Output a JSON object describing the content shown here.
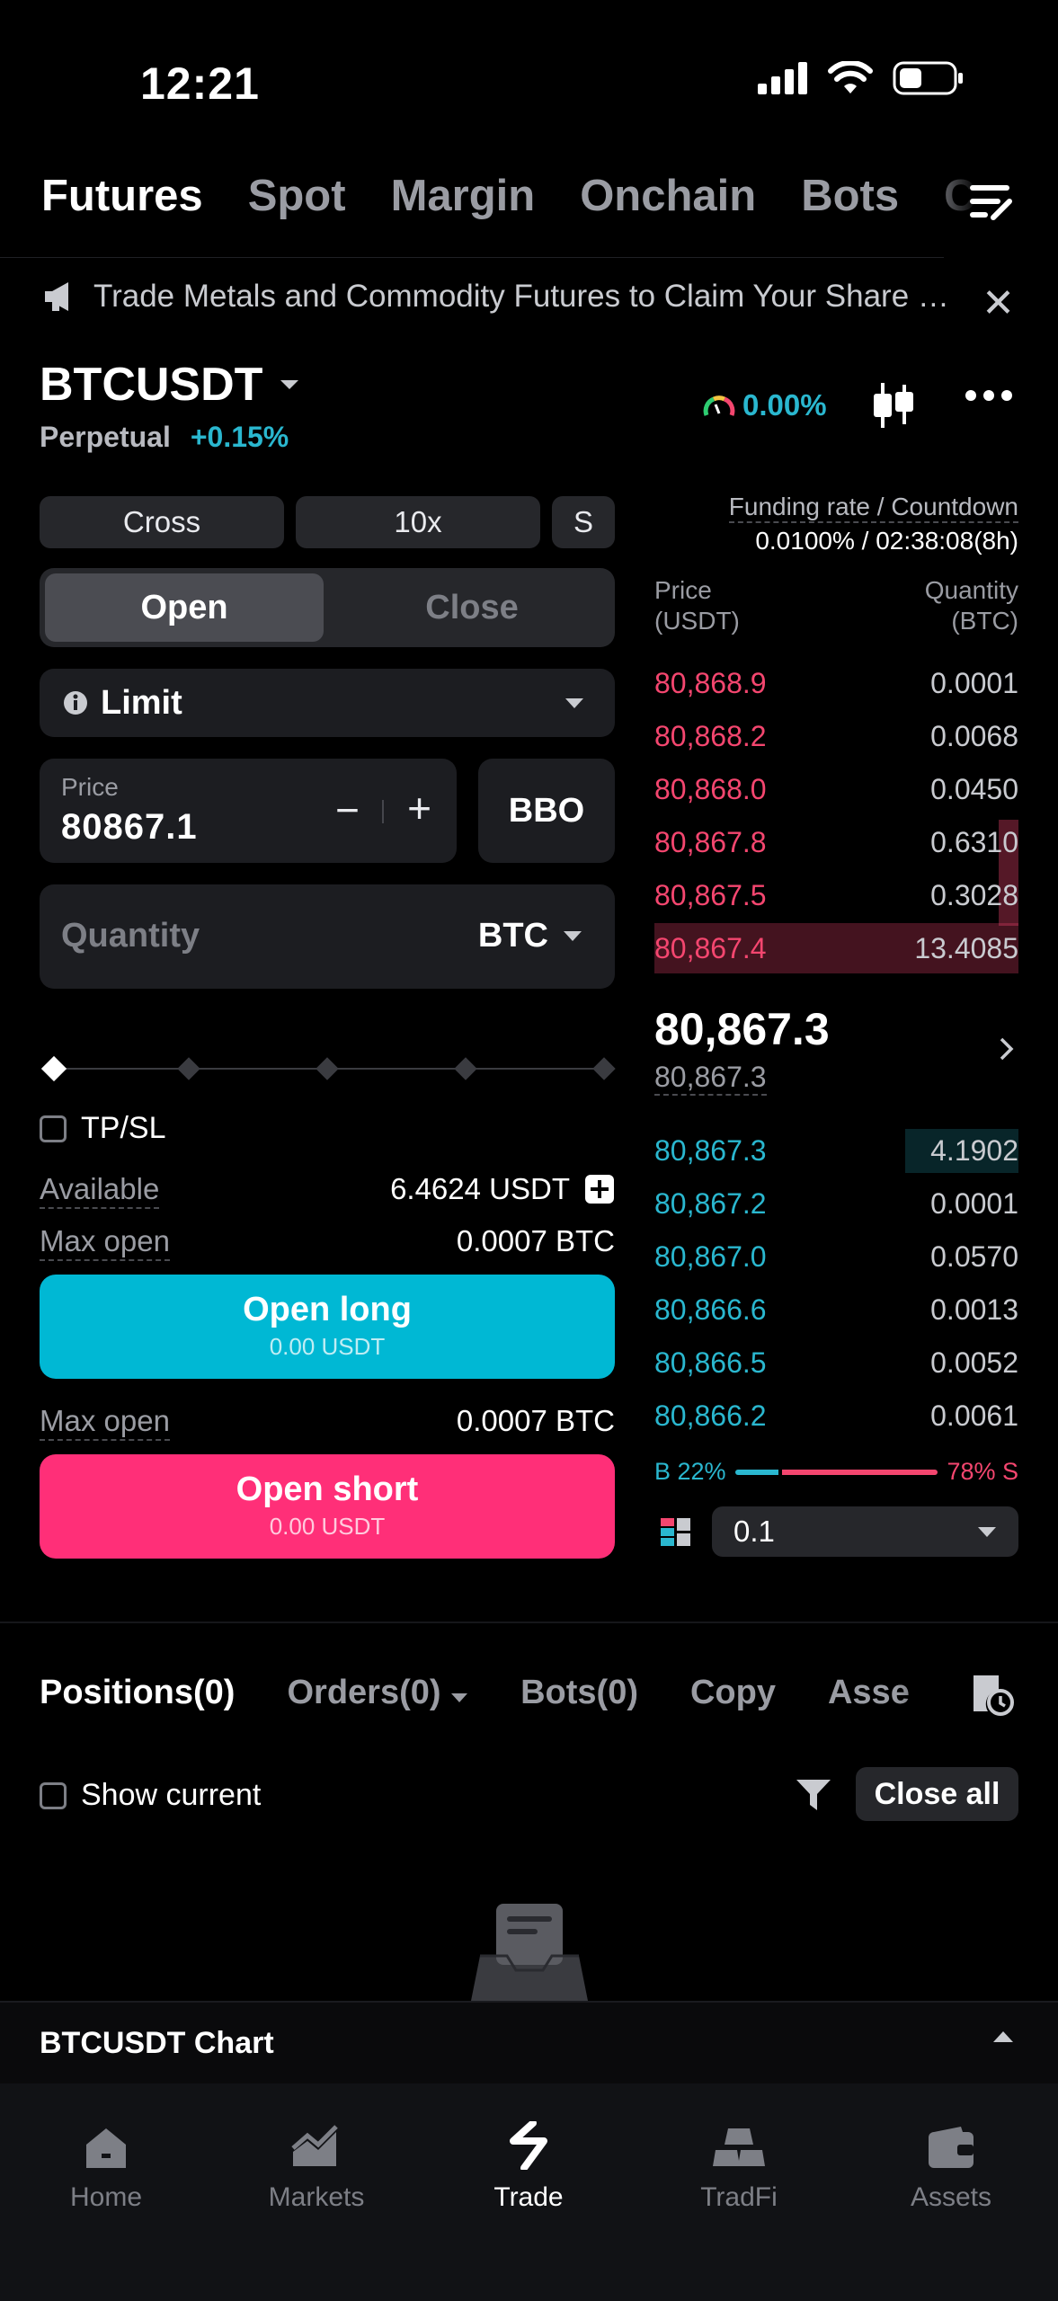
{
  "status_bar": {
    "time": "12:21"
  },
  "top_tabs": [
    "Futures",
    "Spot",
    "Margin",
    "Onchain",
    "Bots",
    "C"
  ],
  "banner": {
    "text": "Trade Metals and Commodity Futures to Claim Your Share o..."
  },
  "symbol": {
    "name": "BTCUSDT",
    "type": "Perpetual",
    "change": "+0.15%",
    "gauge_value": "0.00%"
  },
  "order_form": {
    "margin_mode": "Cross",
    "leverage": "10x",
    "position_mode": "S",
    "open_tab": "Open",
    "close_tab": "Close",
    "order_type": "Limit",
    "price_label": "Price",
    "price_value": "80867.1",
    "bbo_label": "BBO",
    "quantity_placeholder": "Quantity",
    "quantity_unit": "BTC",
    "slider_position": 0,
    "tpsl_label": "TP/SL",
    "available_label": "Available",
    "available_value": "6.4624 USDT",
    "max_open_label": "Max open",
    "max_open_long": "0.0007 BTC",
    "max_open_short": "0.0007 BTC",
    "open_long_label": "Open long",
    "open_long_cost": "0.00 USDT",
    "open_short_label": "Open short",
    "open_short_cost": "0.00 USDT"
  },
  "orderbook": {
    "funding_label": "Funding rate / Countdown",
    "funding_value": "0.0100% / 02:38:08(8h)",
    "price_header": "Price",
    "price_unit": "(USDT)",
    "qty_header": "Quantity",
    "qty_unit": "(BTC)",
    "asks": [
      {
        "price": "80,868.9",
        "qty": "0.0001"
      },
      {
        "price": "80,868.2",
        "qty": "0.0068"
      },
      {
        "price": "80,868.0",
        "qty": "0.0450"
      },
      {
        "price": "80,867.8",
        "qty": "0.6310"
      },
      {
        "price": "80,867.5",
        "qty": "0.3028"
      },
      {
        "price": "80,867.4",
        "qty": "13.4085"
      }
    ],
    "last_price": "80,867.3",
    "mark_price": "80,867.3",
    "bids": [
      {
        "price": "80,867.3",
        "qty": "4.1902"
      },
      {
        "price": "80,867.2",
        "qty": "0.0001"
      },
      {
        "price": "80,867.0",
        "qty": "0.0570"
      },
      {
        "price": "80,866.6",
        "qty": "0.0013"
      },
      {
        "price": "80,866.5",
        "qty": "0.0052"
      },
      {
        "price": "80,866.2",
        "qty": "0.0061"
      }
    ],
    "buy_ratio_label": "B 22%",
    "sell_ratio_label": "78% S",
    "buy_ratio": 22,
    "sell_ratio": 78,
    "depth_step": "0.1"
  },
  "positions": {
    "tabs": [
      "Positions(0)",
      "Orders(0)",
      "Bots(0)",
      "Copy",
      "Asse"
    ],
    "show_current_label": "Show current",
    "close_all_label": "Close all"
  },
  "chart_bar": {
    "label": "BTCUSDT  Chart"
  },
  "bottom_nav": [
    "Home",
    "Markets",
    "Trade",
    "TradFi",
    "Assets"
  ],
  "colors": {
    "buy": "#2ab7cf",
    "sell": "#f4466f",
    "long_button": "#00b8d4",
    "short_button": "#ff2f78"
  }
}
